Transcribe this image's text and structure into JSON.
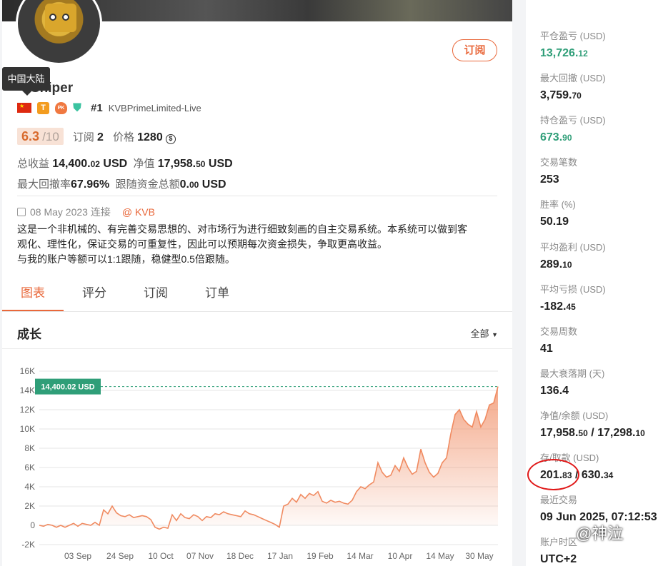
{
  "profile": {
    "tooltip": "中国大陆",
    "username": "Sniper",
    "subscribe_label": "订阅",
    "rank": "#1",
    "broker": "KVBPrimeLimited-Live",
    "score": "6.3",
    "score_max": "/10",
    "subs_label": "订阅",
    "subs_value": "2",
    "price_label": "价格",
    "price_value": "1280",
    "total_profit_label": "总收益",
    "total_profit_int": "14,400.",
    "total_profit_dec": "02",
    "equity_label": "净值",
    "equity_int": "17,958.",
    "equity_dec": "50",
    "currency": "USD",
    "max_dd_rate_label": "最大回撤率",
    "max_dd_rate_value": "67.96%",
    "follow_funds_label": "跟随资金总额",
    "follow_funds_int": "0.",
    "follow_funds_dec": "00",
    "date_text": "08 May 2023 连接",
    "source": "@ KVB",
    "description": [
      "这是一个非机械的、有完善交易思想的、对市场行为进行细致刻画的自主交易系统。本系统可以做到客",
      "观化、理性化，保证交易的可重复性，因此可以预期每次资金损失，争取更高收益。",
      "与我的账户等额可以1:1跟随，稳健型0.5倍跟随。"
    ]
  },
  "tabs": [
    "图表",
    "评分",
    "订阅",
    "订单"
  ],
  "chart_header": {
    "title": "成长",
    "filter": "全部"
  },
  "chart_data": {
    "type": "area",
    "ylim": [
      -2000,
      16000
    ],
    "yticks": [
      -2000,
      0,
      2000,
      4000,
      6000,
      8000,
      10000,
      12000,
      14000,
      16000
    ],
    "ytick_labels": [
      "-2K",
      "0",
      "2K",
      "4K",
      "6K",
      "8K",
      "10K",
      "12K",
      "14K",
      "16K"
    ],
    "xtick_labels": [
      "03 Sep",
      "24 Sep",
      "10 Oct",
      "07 Nov",
      "18 Dec",
      "17 Jan",
      "19 Feb",
      "14 Mar",
      "10 Apr",
      "14 May",
      "30 May"
    ],
    "current_label": "14,400.02 USD",
    "current_value": 14400.02,
    "line_color": "#f08a60",
    "label_color": "#2f9e78",
    "values": [
      0,
      -100,
      100,
      0,
      -200,
      0,
      -200,
      0,
      200,
      -100,
      200,
      100,
      0,
      300,
      0,
      1600,
      1200,
      2000,
      1300,
      1000,
      900,
      1100,
      800,
      900,
      1000,
      900,
      600,
      -200,
      -400,
      -200,
      -300,
      1100,
      500,
      1200,
      800,
      700,
      1100,
      900,
      500,
      900,
      800,
      1200,
      1100,
      1400,
      1200,
      1100,
      1000,
      900,
      1500,
      1200,
      1100,
      900,
      700,
      500,
      300,
      100,
      -200,
      2000,
      2200,
      2800,
      2400,
      3200,
      2800,
      3300,
      3100,
      3500,
      2500,
      2300,
      2600,
      2400,
      2500,
      2300,
      2200,
      2600,
      3500,
      4000,
      3800,
      4200,
      4500,
      6500,
      5500,
      5000,
      5200,
      6200,
      5600,
      7000,
      6000,
      5300,
      5600,
      7900,
      6500,
      5500,
      5000,
      5400,
      6500,
      7000,
      9500,
      11500,
      12000,
      11000,
      10500,
      10200,
      11800,
      10200,
      11000,
      12500,
      12700,
      14400
    ]
  },
  "metrics": [
    {
      "label": "平仓盈亏",
      "unit": "(USD)",
      "int": "13,726.",
      "dec": "12",
      "color": "green"
    },
    {
      "label": "最大回撤",
      "unit": "(USD)",
      "int": "3,759.",
      "dec": "70",
      "color": ""
    },
    {
      "label": "持仓盈亏",
      "unit": "(USD)",
      "int": "673.",
      "dec": "90",
      "color": "green"
    },
    {
      "label": "交易笔数",
      "unit": "",
      "int": "253",
      "dec": "",
      "color": ""
    },
    {
      "label": "胜率",
      "unit": "(%)",
      "int": "50.19",
      "dec": "",
      "color": ""
    },
    {
      "label": "平均盈利",
      "unit": "(USD)",
      "int": "289.",
      "dec": "10",
      "color": ""
    },
    {
      "label": "平均亏损",
      "unit": "(USD)",
      "int": "-182.",
      "dec": "45",
      "color": ""
    },
    {
      "label": "交易周数",
      "unit": "",
      "int": "41",
      "dec": "",
      "color": ""
    },
    {
      "label": "最大衰落期",
      "unit": "(天)",
      "int": "136.4",
      "dec": "",
      "color": ""
    },
    {
      "label": "净值/余额",
      "unit": "(USD)",
      "int": "17,958.",
      "dec": "50",
      "int2": "17,298.",
      "dec2": "10",
      "color": ""
    },
    {
      "label": "存/取款",
      "unit": "(USD)",
      "int": "201.",
      "dec": "83",
      "int2": "630.",
      "dec2": "34",
      "color": ""
    },
    {
      "label": "最近交易",
      "unit": "",
      "int": "09 Jun 2025, 07:12:53",
      "dec": "",
      "color": ""
    },
    {
      "label": "账户时区",
      "unit": "",
      "int": "UTC+2",
      "dec": "",
      "color": ""
    }
  ],
  "watermark": "@神泣"
}
